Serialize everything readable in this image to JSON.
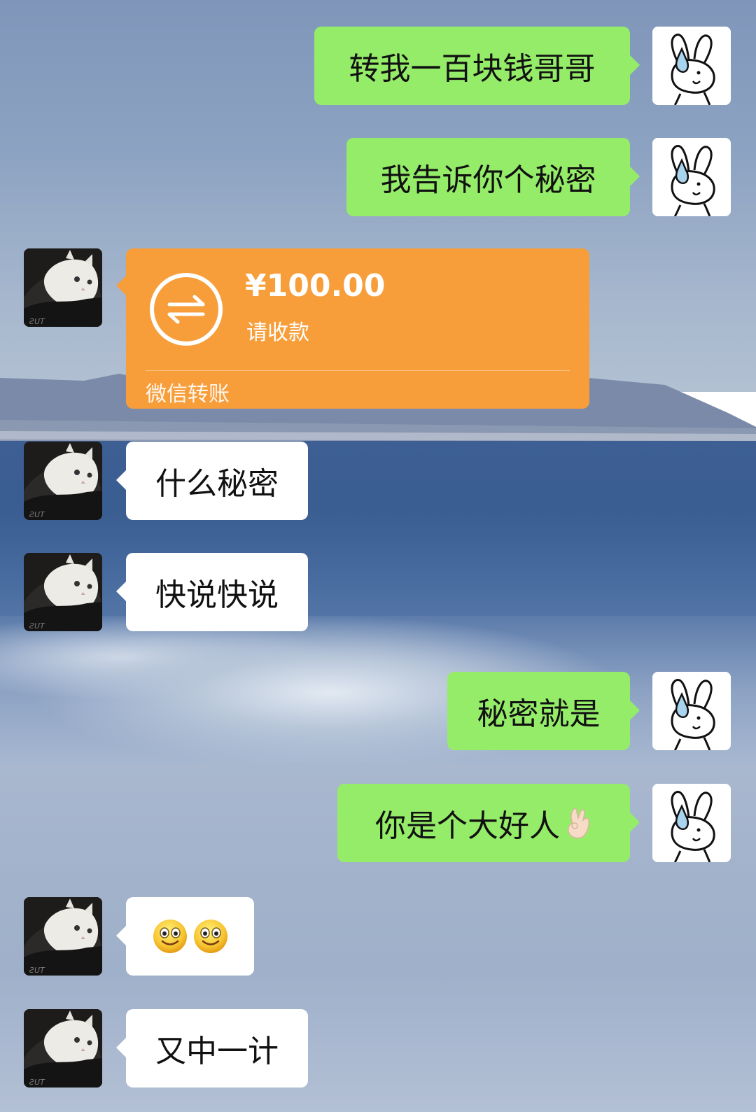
{
  "conversation": {
    "messages": [
      {
        "id": "m1",
        "side": "right",
        "type": "text",
        "text": "转我一百块钱哥哥"
      },
      {
        "id": "m2",
        "side": "right",
        "type": "text",
        "text": "我告诉你个秘密"
      },
      {
        "id": "m3",
        "side": "left",
        "type": "transfer",
        "amount": "¥100.00",
        "status": "请收款",
        "footer": "微信转账"
      },
      {
        "id": "m4",
        "side": "left",
        "type": "text",
        "text": "什么秘密"
      },
      {
        "id": "m5",
        "side": "left",
        "type": "text",
        "text": "快说快说"
      },
      {
        "id": "m6",
        "side": "right",
        "type": "text",
        "text": "秘密就是"
      },
      {
        "id": "m7",
        "side": "right",
        "type": "text",
        "text": "你是个大好人",
        "trailing_emoji": "ok-hand-emoji"
      },
      {
        "id": "m8",
        "side": "left",
        "type": "emoji",
        "emojis": [
          "smiley-face-emoji",
          "smiley-face-emoji"
        ]
      },
      {
        "id": "m9",
        "side": "left",
        "type": "text",
        "text": "又中一计"
      }
    ]
  },
  "colors": {
    "outgoing_bubble": "#95ec69",
    "incoming_bubble": "#ffffff",
    "transfer_card": "#f79e3b"
  },
  "avatars": {
    "self": "bunny-avatar",
    "contact": "white-cat-avatar"
  }
}
